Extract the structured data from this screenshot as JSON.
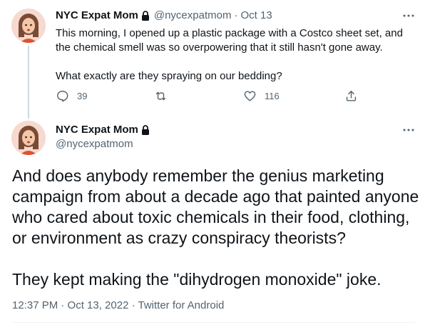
{
  "tweet1": {
    "display_name": "NYC Expat Mom",
    "handle": "@nycexpatmom",
    "separator": "·",
    "date": "Oct 13",
    "text_p1": "This morning, I opened up a plastic package with a Costco sheet set, and the chemical smell was so overpowering that it still hasn't gone away.",
    "text_p2": "What exactly are they spraying on our bedding?",
    "reply_count": "39",
    "like_count": "116"
  },
  "tweet2": {
    "display_name": "NYC Expat Mom",
    "handle": "@nycexpatmom",
    "text_p1": "And does anybody remember the  genius marketing campaign from about a decade ago that painted anyone who cared about toxic chemicals in their food, clothing, or environment as crazy conspiracy theorists?",
    "text_p2": "They kept making the \"dihydrogen monoxide\" joke.",
    "meta": "12:37 PM · Oct 13, 2022 · Twitter for Android"
  },
  "colors": {
    "text_primary": "#0f1419",
    "text_secondary": "#536471",
    "thread_line": "#cfd9de",
    "avatar_bg": "#f6d9cf",
    "avatar_hair": "#7a4a34",
    "avatar_shirt": "#e0522f"
  },
  "icons": [
    "lock-icon",
    "more-icon",
    "reply-icon",
    "retweet-icon",
    "like-icon",
    "share-icon"
  ]
}
